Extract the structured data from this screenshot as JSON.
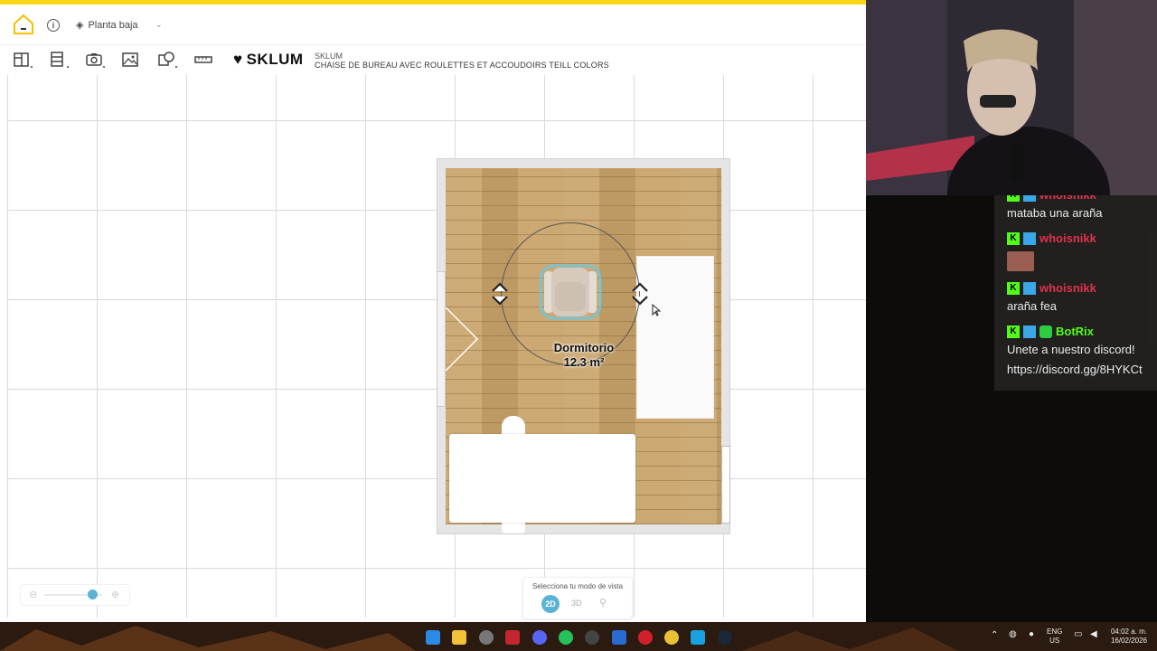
{
  "app": {
    "floor_selector": "Planta baja",
    "brand": "SKLUM",
    "product_brand_small": "SKLUM",
    "product_name": "CHAISE DE BUREAU AVEC ROULETTES ET ACCOUDOIRS TEILL COLORS",
    "room": {
      "name": "Dormitorio",
      "area": "12.3 m²"
    },
    "view_mode": {
      "label": "Selecciona tu modo de vista",
      "mode_2d": "2D",
      "mode_3d": "3D",
      "selected": "2D"
    },
    "zoom": {
      "level": 0.75
    },
    "colors": {
      "accent": "#f6d51b",
      "selection": "#5ab3d5",
      "wood": "#c9a46a"
    }
  },
  "chat": {
    "messages": [
      {
        "user": "whoisnikk",
        "text": "mataba una araña"
      },
      {
        "user": "whoisnikk",
        "text": ""
      },
      {
        "user": "whoisnikk",
        "text": "araña fea"
      },
      {
        "user": "BotRix",
        "text": "Unete a nuestro discord!",
        "link": "https://discord.gg/8HYKCt"
      }
    ]
  },
  "taskbar": {
    "lang_top": "ENG",
    "lang_bottom": "US",
    "time": "04:02 a. m.",
    "date": "16/02/2026"
  }
}
